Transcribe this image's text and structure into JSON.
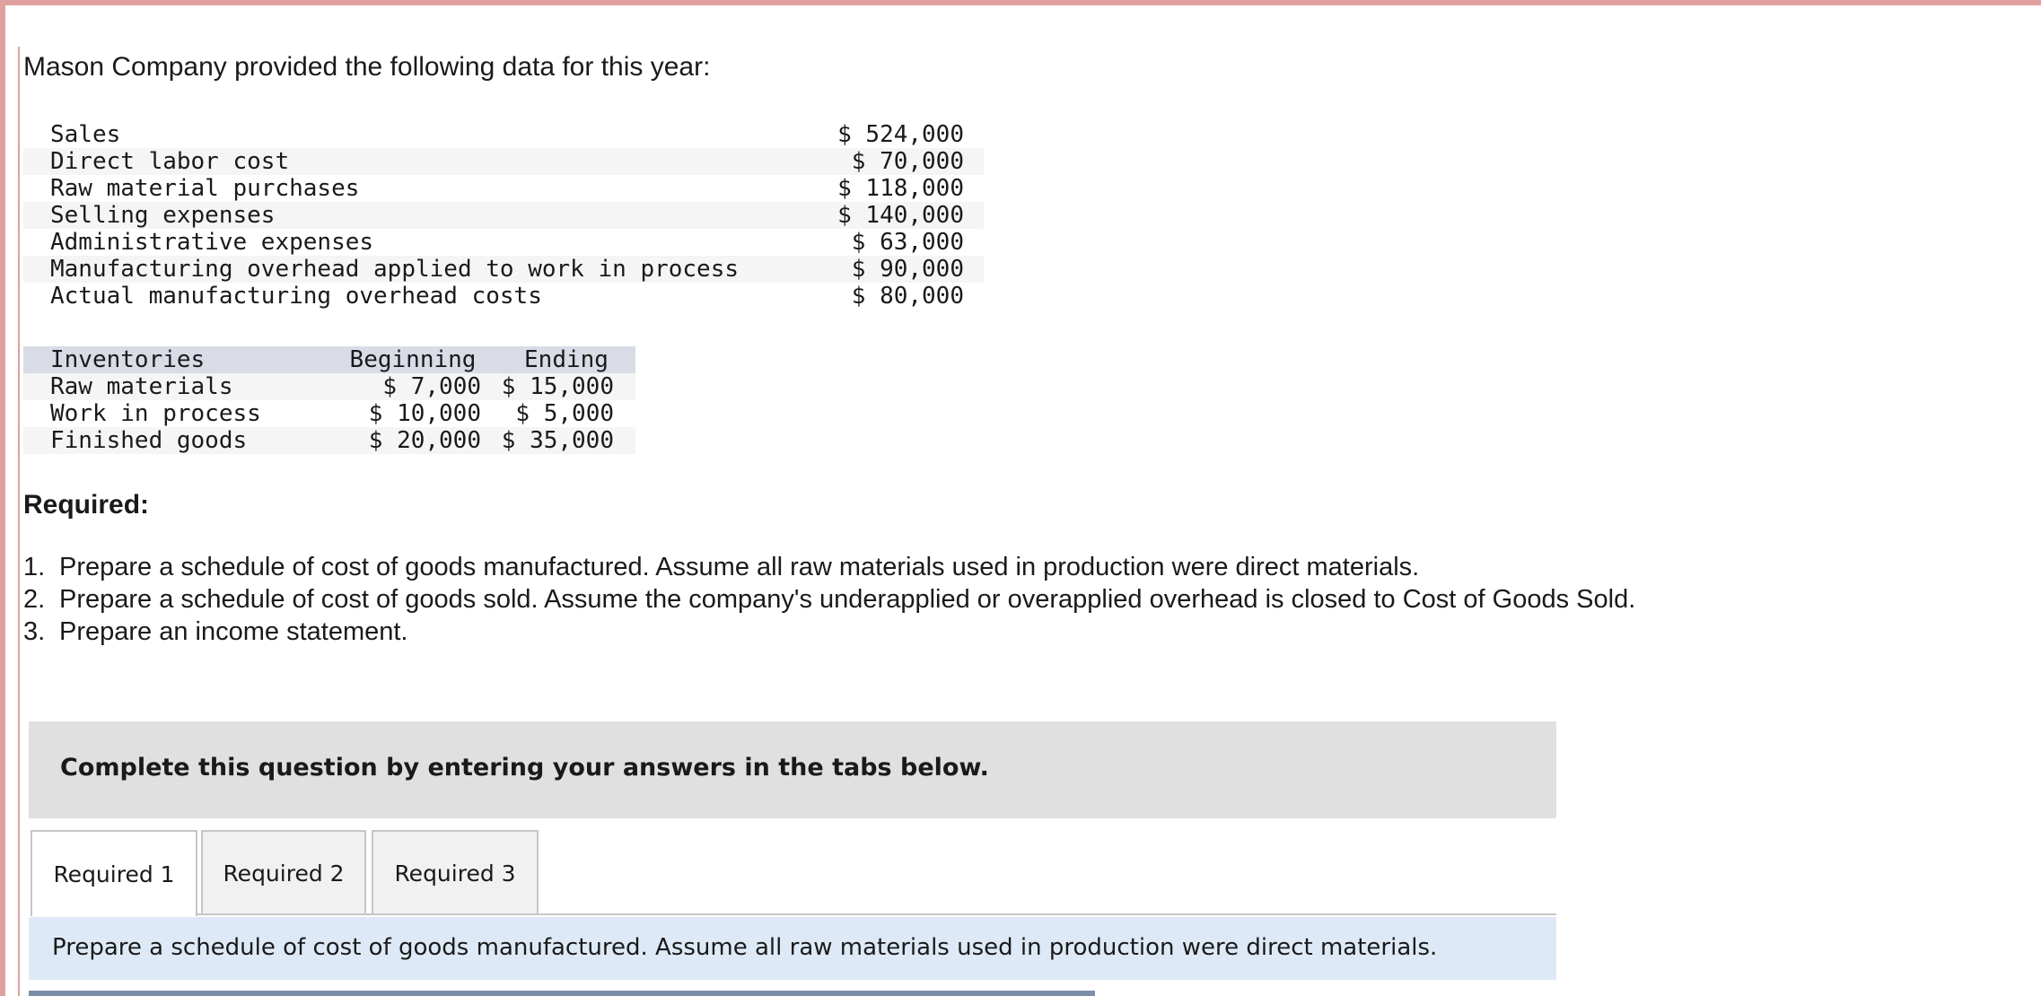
{
  "intro_text": "Mason Company provided the following data for this year:",
  "data_rows": [
    {
      "label": "Sales",
      "value": "$ 524,000"
    },
    {
      "label": "Direct labor cost",
      "value": "$ 70,000"
    },
    {
      "label": "Raw material purchases",
      "value": "$ 118,000"
    },
    {
      "label": "Selling expenses",
      "value": "$ 140,000"
    },
    {
      "label": "Administrative expenses",
      "value": "$ 63,000"
    },
    {
      "label": "Manufacturing overhead applied to work in process",
      "value": "$ 90,000"
    },
    {
      "label": "Actual manufacturing overhead costs",
      "value": "$ 80,000"
    }
  ],
  "inventories": {
    "headers": [
      "Inventories",
      "Beginning",
      "Ending"
    ],
    "rows": [
      {
        "label": "Raw materials",
        "beginning": "$ 7,000",
        "ending": "$ 15,000"
      },
      {
        "label": "Work in process",
        "beginning": "$ 10,000",
        "ending": "$ 5,000"
      },
      {
        "label": "Finished goods",
        "beginning": "$ 20,000",
        "ending": "$ 35,000"
      }
    ]
  },
  "required_heading": "Required:",
  "required_items": [
    {
      "num": "1.",
      "text": "Prepare a schedule of cost of goods manufactured. Assume all raw materials used in production were direct materials."
    },
    {
      "num": "2.",
      "text": "Prepare a schedule of cost of goods sold. Assume the company's underapplied or overapplied overhead is closed to Cost of Goods Sold."
    },
    {
      "num": "3.",
      "text": "Prepare an income statement."
    }
  ],
  "instruction": "Complete this question by entering your answers in the tabs below.",
  "tabs": [
    {
      "label": "Required 1",
      "active": true
    },
    {
      "label": "Required 2",
      "active": false
    },
    {
      "label": "Required 3",
      "active": false
    }
  ],
  "active_tab_prompt": "Prepare a schedule of cost of goods manufactured. Assume all raw materials used in production were direct materials.",
  "colors": {
    "frame_border": "#e0a09d",
    "instruction_bg": "#e0e0e0",
    "tab_panel_bg": "#dde9f6",
    "inventory_header_bg": "#d9dce6"
  }
}
